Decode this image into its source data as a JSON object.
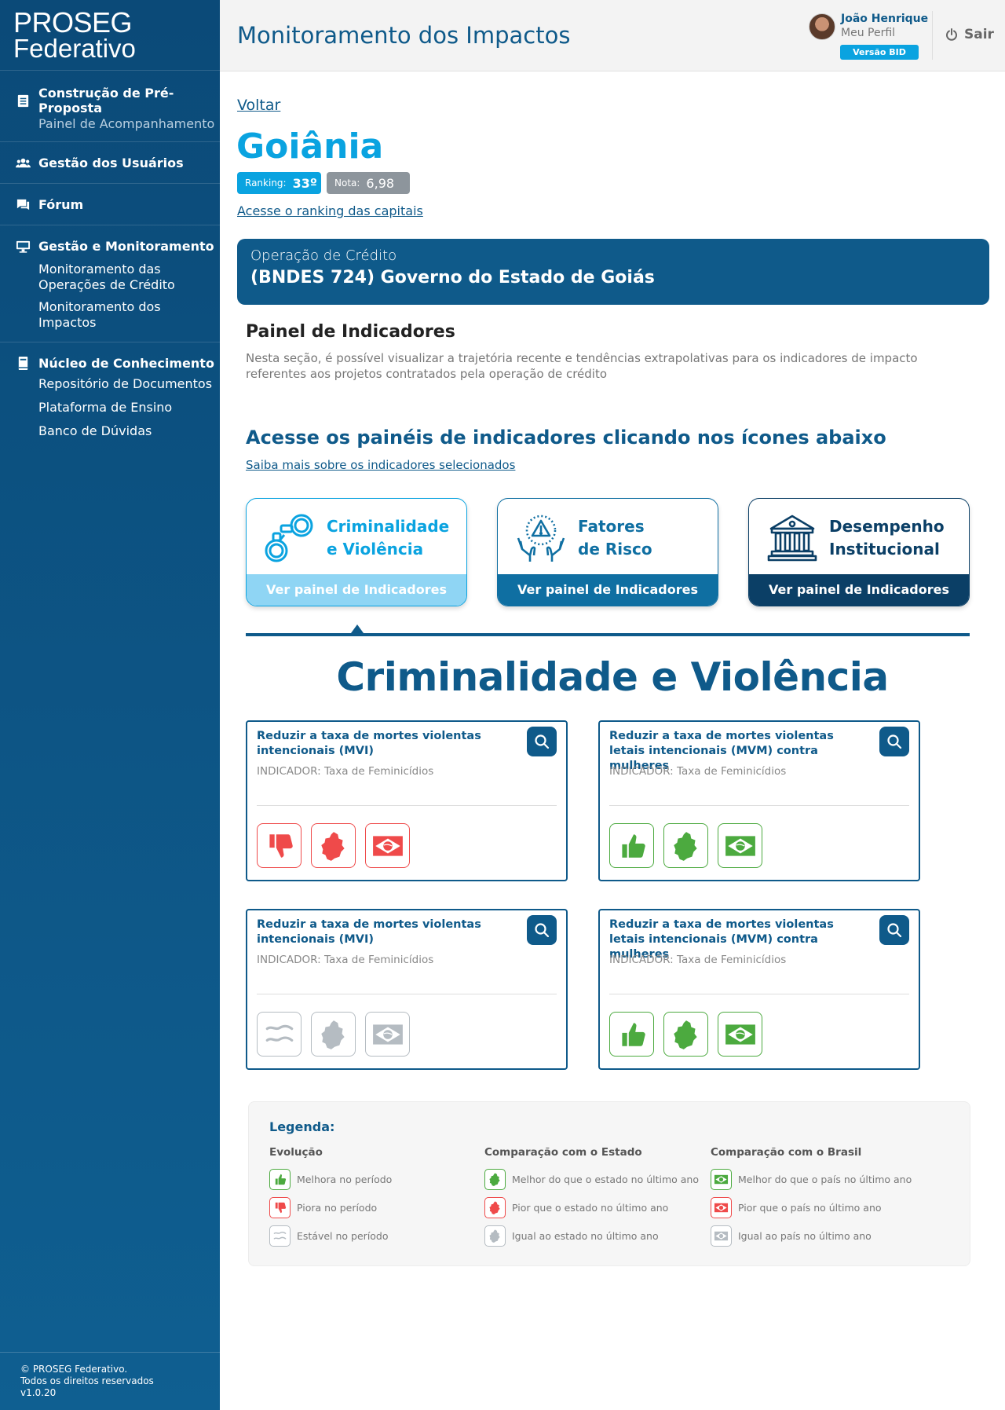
{
  "logo": {
    "line1": "PROSEG",
    "line2": "Federativo"
  },
  "sidebar": {
    "sections": [
      {
        "label": "Construção de Pré-Proposta",
        "icon": "document-icon",
        "subs": [
          "Painel de Acompanhamento"
        ]
      },
      {
        "label": "Gestão dos Usuários",
        "icon": "users-icon",
        "subs": []
      },
      {
        "label": "Fórum",
        "icon": "chat-icon",
        "subs": []
      },
      {
        "label": "Gestão e Monitoramento",
        "icon": "monitor-icon",
        "subs": [
          "Monitoramento das Operações de Crédito",
          "Monitoramento dos Impactos"
        ]
      },
      {
        "label": "Núcleo de Conhecimento",
        "icon": "book-icon",
        "subs": [
          "Repositório de Documentos",
          "Plataforma de Ensino",
          "Banco de Dúvidas"
        ]
      }
    ],
    "footer": [
      "© PROSEG Federativo.",
      "Todos os direitos reservados",
      "v1.0.20"
    ]
  },
  "header": {
    "title": "Monitoramento dos Impactos",
    "user_name": "João Henrique",
    "user_profile": "Meu Perfil",
    "version_badge": "Versão BID",
    "logout": "Sair"
  },
  "page": {
    "back": "Voltar",
    "city": "Goiânia",
    "ranking_label": "Ranking:",
    "ranking_value": "33º",
    "nota_label": "Nota:",
    "nota_value": "6,98",
    "ranking_link": "Acesse o ranking das capitais",
    "operation_label": "Operação de Crédito",
    "operation_name": "(BNDES 724) Governo do Estado de Goiás",
    "panel_title": "Painel de Indicadores",
    "panel_desc": "Nesta seção, é possível visualizar a trajetória recente e tendências extrapolativas para os indicadores de impacto referentes aos projetos contratados pela operação de crédito",
    "access_title": "Acesse os painéis de indicadores clicando nos ícones abaixo",
    "access_link": "Saiba mais sobre os indicadores selecionados",
    "section_heading": "Criminalidade e Violência"
  },
  "categories": [
    {
      "line1": "Criminalidade",
      "line2": "e Violência",
      "button": "Ver painel de Indicadores",
      "icon": "handcuffs-icon"
    },
    {
      "line1": "Fatores",
      "line2": "de Risco",
      "button": "Ver painel de Indicadores",
      "icon": "risk-hands-icon"
    },
    {
      "line1": "Desempenho",
      "line2": "Institucional",
      "button": "Ver painel de Indicadores",
      "icon": "institution-icon"
    }
  ],
  "indicators": [
    {
      "title": "Reduzir a taxa de mortes violentas intencionais (MVI)",
      "subtitle": "INDICADOR: Taxa de Feminicídios",
      "status": [
        "thumbs-down-red",
        "state-red",
        "brazil-red"
      ]
    },
    {
      "title": "Reduzir a taxa de mortes violentas letais intencionais (MVM) contra mulheres",
      "subtitle": "INDICADOR: Taxa de Feminicídios",
      "status": [
        "thumbs-up-green",
        "state-green",
        "brazil-green"
      ]
    },
    {
      "title": "Reduzir a taxa de mortes violentas intencionais (MVI)",
      "subtitle": "INDICADOR: Taxa de Feminicídios",
      "status": [
        "stable-gray",
        "state-gray",
        "brazil-gray"
      ]
    },
    {
      "title": "Reduzir a taxa de mortes violentas letais intencionais (MVM) contra mulheres",
      "subtitle": "INDICADOR: Taxa de Feminicídios",
      "status": [
        "thumbs-up-green",
        "state-green",
        "brazil-green"
      ]
    }
  ],
  "legend": {
    "title": "Legenda:",
    "col1": {
      "heading": "Evolução",
      "items": [
        "Melhora no período",
        "Piora no período",
        "Estável no período"
      ]
    },
    "col2": {
      "heading": "Comparação com o Estado",
      "items": [
        "Melhor do que o estado no último ano",
        "Pior que o estado no último ano",
        "Igual ao estado no último ano"
      ]
    },
    "col3": {
      "heading": "Comparação com o Brasil",
      "items": [
        "Melhor do que o país no último ano",
        "Pior que o país no último ano",
        "Igual ao país no último ano"
      ]
    }
  },
  "colors": {
    "primary": "#0f5a8a",
    "accent": "#0aa3e0",
    "good": "#4caa3f",
    "bad": "#ef4a4a",
    "neutral": "#b5bcc2"
  }
}
